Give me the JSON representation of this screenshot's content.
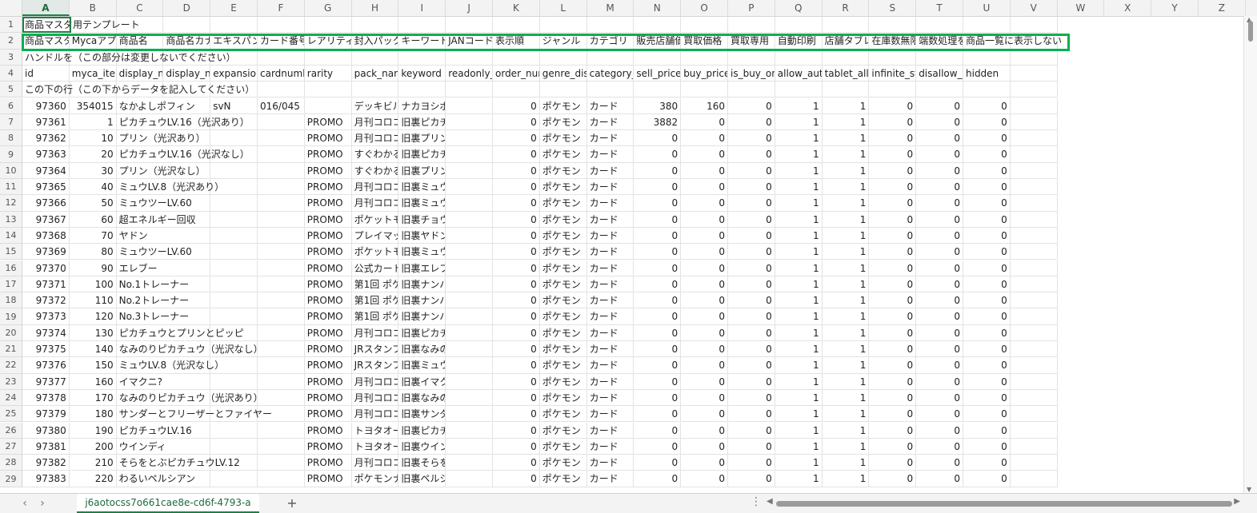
{
  "sheet_tab": "j6aotocss7o661cae8e-cd6f-4793-a",
  "columns": [
    "A",
    "B",
    "C",
    "D",
    "E",
    "F",
    "G",
    "H",
    "I",
    "J",
    "K",
    "L",
    "M",
    "N",
    "O",
    "P",
    "Q",
    "R",
    "S",
    "T",
    "U",
    "V",
    "W",
    "X",
    "Y",
    "Z"
  ],
  "active_column": "A",
  "rows": [
    {
      "n": "1",
      "cells": {
        "A": "商品マスタ用テンプレート"
      }
    },
    {
      "n": "2",
      "cells": {
        "A": "商品マスタ",
        "B": "Mycaアプ",
        "C": "商品名",
        "D": "商品名カナ",
        "E": "エキスパン",
        "F": "カード番号",
        "G": "レアリティ",
        "H": "封入パック",
        "I": "キーワード",
        "J": "JANコード",
        "K": "表示順",
        "L": "ジャンル",
        "M": "カテゴリ",
        "N": "販売店舗価",
        "O": "買取価格",
        "P": "買取専用",
        "Q": "自動印刷",
        "R": "店舗タブレ",
        "S": "在庫数無限",
        "T": "端数処理を",
        "U": "商品一覧に表示しない"
      }
    },
    {
      "n": "3",
      "cells": {
        "A": "ハンドルを（この部分は変更しないでください）"
      }
    },
    {
      "n": "4",
      "cells": {
        "A": "id",
        "B": "myca_item",
        "C": "display_na",
        "D": "display_na",
        "E": "expansion",
        "F": "cardnumb",
        "G": "rarity",
        "H": "pack_nam",
        "I": "keyword",
        "J": "readonly_j",
        "K": "order_num",
        "L": "genre_dis",
        "M": "category_d",
        "N": "sell_price",
        "O": "buy_price",
        "P": "is_buy_on",
        "Q": "allow_auto",
        "R": "tablet_allo",
        "S": "infinite_st",
        "T": "disallow_r",
        "U": "hidden"
      }
    },
    {
      "n": "5",
      "cells": {
        "A": "この下の行（この下からデータを記入してください）"
      }
    },
    {
      "n": "6",
      "cells": {
        "A": "97360",
        "B": "354015",
        "C": "なかよしポフィン",
        "E": "svN",
        "F": "016/045",
        "H": "デッキビル",
        "I": "ナカヨシポフィン な",
        "K": "0",
        "L": "ポケモン",
        "M": "カード",
        "N": "380",
        "O": "160",
        "P": "0",
        "Q": "1",
        "R": "1",
        "S": "0",
        "T": "0",
        "U": "0"
      }
    },
    {
      "n": "7",
      "cells": {
        "A": "97361",
        "B": "1",
        "C": "ピカチュウLV.16（光沢あり）",
        "G": "PROMO",
        "H": "月刊コロコ",
        "I": "旧裏ピカチュウ ピカ",
        "K": "0",
        "L": "ポケモン",
        "M": "カード",
        "N": "3882",
        "O": "0",
        "P": "0",
        "Q": "1",
        "R": "1",
        "S": "0",
        "T": "0",
        "U": "0"
      }
    },
    {
      "n": "8",
      "cells": {
        "A": "97362",
        "B": "10",
        "C": "プリン（光沢あり）",
        "G": "PROMO",
        "H": "月刊コロコ",
        "I": "旧裏プリン プリン ぷ",
        "K": "0",
        "L": "ポケモン",
        "M": "カード",
        "N": "0",
        "O": "0",
        "P": "0",
        "Q": "1",
        "R": "1",
        "S": "0",
        "T": "0",
        "U": "0"
      }
    },
    {
      "n": "9",
      "cells": {
        "A": "97363",
        "B": "20",
        "C": "ピカチュウLV.16（光沢なし）",
        "G": "PROMO",
        "H": "すぐわかる",
        "I": "旧裏ピカチュウ ピカ",
        "K": "0",
        "L": "ポケモン",
        "M": "カード",
        "N": "0",
        "O": "0",
        "P": "0",
        "Q": "1",
        "R": "1",
        "S": "0",
        "T": "0",
        "U": "0"
      }
    },
    {
      "n": "10",
      "cells": {
        "A": "97364",
        "B": "30",
        "C": "プリン（光沢なし）",
        "G": "PROMO",
        "H": "すぐわかる",
        "I": "旧裏プリン プリン ぷ",
        "K": "0",
        "L": "ポケモン",
        "M": "カード",
        "N": "0",
        "O": "0",
        "P": "0",
        "Q": "1",
        "R": "1",
        "S": "0",
        "T": "0",
        "U": "0"
      }
    },
    {
      "n": "11",
      "cells": {
        "A": "97365",
        "B": "40",
        "C": "ミュウLV.8（光沢あり）",
        "G": "PROMO",
        "H": "月刊コロコ",
        "I": "旧裏ミュウ ミュウ み",
        "K": "0",
        "L": "ポケモン",
        "M": "カード",
        "N": "0",
        "O": "0",
        "P": "0",
        "Q": "1",
        "R": "1",
        "S": "0",
        "T": "0",
        "U": "0"
      }
    },
    {
      "n": "12",
      "cells": {
        "A": "97366",
        "B": "50",
        "C": "ミュウツーLV.60",
        "G": "PROMO",
        "H": "月刊コロコ",
        "I": "旧裏ミュウツー ミュ",
        "K": "0",
        "L": "ポケモン",
        "M": "カード",
        "N": "0",
        "O": "0",
        "P": "0",
        "Q": "1",
        "R": "1",
        "S": "0",
        "T": "0",
        "U": "0"
      }
    },
    {
      "n": "13",
      "cells": {
        "A": "97367",
        "B": "60",
        "C": "超エネルギー回収",
        "G": "PROMO",
        "H": "ポケットモ",
        "I": "旧裏チョウエネルギー",
        "K": "0",
        "L": "ポケモン",
        "M": "カード",
        "N": "0",
        "O": "0",
        "P": "0",
        "Q": "1",
        "R": "1",
        "S": "0",
        "T": "0",
        "U": "0"
      }
    },
    {
      "n": "14",
      "cells": {
        "A": "97368",
        "B": "70",
        "C": "ヤドン",
        "G": "PROMO",
        "H": "プレイマッ",
        "I": "旧裏ヤドン やどん",
        "K": "0",
        "L": "ポケモン",
        "M": "カード",
        "N": "0",
        "O": "0",
        "P": "0",
        "Q": "1",
        "R": "1",
        "S": "0",
        "T": "0",
        "U": "0"
      }
    },
    {
      "n": "15",
      "cells": {
        "A": "97369",
        "B": "80",
        "C": "ミュウツーLV.60",
        "G": "PROMO",
        "H": "ポケットモ",
        "I": "旧裏ミュウツー ミュ",
        "K": "0",
        "L": "ポケモン",
        "M": "カード",
        "N": "0",
        "O": "0",
        "P": "0",
        "Q": "1",
        "R": "1",
        "S": "0",
        "T": "0",
        "U": "0"
      }
    },
    {
      "n": "16",
      "cells": {
        "A": "97370",
        "B": "90",
        "C": "エレブー",
        "G": "PROMO",
        "H": "公式カート",
        "I": "旧裏エレブー えれぶ",
        "K": "0",
        "L": "ポケモン",
        "M": "カード",
        "N": "0",
        "O": "0",
        "P": "0",
        "Q": "1",
        "R": "1",
        "S": "0",
        "T": "0",
        "U": "0"
      }
    },
    {
      "n": "17",
      "cells": {
        "A": "97371",
        "B": "100",
        "C": "No.1トレーナー",
        "G": "PROMO",
        "H": "第1回 ポケ",
        "I": "旧裏ナンバーワントL",
        "K": "0",
        "L": "ポケモン",
        "M": "カード",
        "N": "0",
        "O": "0",
        "P": "0",
        "Q": "1",
        "R": "1",
        "S": "0",
        "T": "0",
        "U": "0"
      }
    },
    {
      "n": "18",
      "cells": {
        "A": "97372",
        "B": "110",
        "C": "No.2トレーナー",
        "G": "PROMO",
        "H": "第1回 ポケ",
        "I": "旧裏ナンバーツートL",
        "K": "0",
        "L": "ポケモン",
        "M": "カード",
        "N": "0",
        "O": "0",
        "P": "0",
        "Q": "1",
        "R": "1",
        "S": "0",
        "T": "0",
        "U": "0"
      }
    },
    {
      "n": "19",
      "cells": {
        "A": "97373",
        "B": "120",
        "C": "No.3トレーナー",
        "G": "PROMO",
        "H": "第1回 ポケ",
        "I": "旧裏ナンバースリー",
        "K": "0",
        "L": "ポケモン",
        "M": "カード",
        "N": "0",
        "O": "0",
        "P": "0",
        "Q": "1",
        "R": "1",
        "S": "0",
        "T": "0",
        "U": "0"
      }
    },
    {
      "n": "20",
      "cells": {
        "A": "97374",
        "B": "130",
        "C": "ピカチュウとプリンとピッピ",
        "G": "PROMO",
        "H": "月刊コロコ",
        "I": "旧裏ピカチュウトプリ",
        "K": "0",
        "L": "ポケモン",
        "M": "カード",
        "N": "0",
        "O": "0",
        "P": "0",
        "Q": "1",
        "R": "1",
        "S": "0",
        "T": "0",
        "U": "0"
      }
    },
    {
      "n": "21",
      "cells": {
        "A": "97375",
        "B": "140",
        "C": "なみのりピカチュウ（光沢なし）",
        "G": "PROMO",
        "H": "JRスタンフ",
        "I": "旧裏なみのりピカチュ",
        "K": "0",
        "L": "ポケモン",
        "M": "カード",
        "N": "0",
        "O": "0",
        "P": "0",
        "Q": "1",
        "R": "1",
        "S": "0",
        "T": "0",
        "U": "0"
      }
    },
    {
      "n": "22",
      "cells": {
        "A": "97376",
        "B": "150",
        "C": "ミュウLV.8（光沢なし）",
        "G": "PROMO",
        "H": "JRスタンフ",
        "I": "旧裏ミュウ ミュウ み",
        "K": "0",
        "L": "ポケモン",
        "M": "カード",
        "N": "0",
        "O": "0",
        "P": "0",
        "Q": "1",
        "R": "1",
        "S": "0",
        "T": "0",
        "U": "0"
      }
    },
    {
      "n": "23",
      "cells": {
        "A": "97377",
        "B": "160",
        "C": "イマクニ?",
        "G": "PROMO",
        "H": "月刊コロコ",
        "I": "旧裏イマクニ いまく",
        "K": "0",
        "L": "ポケモン",
        "M": "カード",
        "N": "0",
        "O": "0",
        "P": "0",
        "Q": "1",
        "R": "1",
        "S": "0",
        "T": "0",
        "U": "0"
      }
    },
    {
      "n": "24",
      "cells": {
        "A": "97378",
        "B": "170",
        "C": "なみのりピカチュウ（光沢あり）",
        "G": "PROMO",
        "H": "月刊コロコ",
        "I": "旧裏なみのりピカチュ",
        "K": "0",
        "L": "ポケモン",
        "M": "カード",
        "N": "0",
        "O": "0",
        "P": "0",
        "Q": "1",
        "R": "1",
        "S": "0",
        "T": "0",
        "U": "0"
      }
    },
    {
      "n": "25",
      "cells": {
        "A": "97379",
        "B": "180",
        "C": "サンダーとフリーザーとファイヤー",
        "G": "PROMO",
        "H": "月刊コロコ",
        "I": "旧裏サンダートフリー",
        "K": "0",
        "L": "ポケモン",
        "M": "カード",
        "N": "0",
        "O": "0",
        "P": "0",
        "Q": "1",
        "R": "1",
        "S": "0",
        "T": "0",
        "U": "0"
      }
    },
    {
      "n": "26",
      "cells": {
        "A": "97380",
        "B": "190",
        "C": "ピカチュウLV.16",
        "G": "PROMO",
        "H": "トヨタオー",
        "I": "旧裏ピカチュウ ピカ",
        "K": "0",
        "L": "ポケモン",
        "M": "カード",
        "N": "0",
        "O": "0",
        "P": "0",
        "Q": "1",
        "R": "1",
        "S": "0",
        "T": "0",
        "U": "0"
      }
    },
    {
      "n": "27",
      "cells": {
        "A": "97381",
        "B": "200",
        "C": "ウインディ",
        "G": "PROMO",
        "H": "トヨタオー",
        "I": "旧裏ウインディ うい",
        "K": "0",
        "L": "ポケモン",
        "M": "カード",
        "N": "0",
        "O": "0",
        "P": "0",
        "Q": "1",
        "R": "1",
        "S": "0",
        "T": "0",
        "U": "0"
      }
    },
    {
      "n": "28",
      "cells": {
        "A": "97382",
        "B": "210",
        "C": "そらをとぶピカチュウLV.12",
        "G": "PROMO",
        "H": "月刊コロコ",
        "I": "旧裏そらをとぶピカチ",
        "K": "0",
        "L": "ポケモン",
        "M": "カード",
        "N": "0",
        "O": "0",
        "P": "0",
        "Q": "1",
        "R": "1",
        "S": "0",
        "T": "0",
        "U": "0"
      }
    },
    {
      "n": "29",
      "cells": {
        "A": "97383",
        "B": "220",
        "C": "わるいペルシアン",
        "G": "PROMO",
        "H": "ポケモンナ",
        "I": "旧裏ペルシアン ぺる",
        "K": "0",
        "L": "ポケモン",
        "M": "カード",
        "N": "0",
        "O": "0",
        "P": "0",
        "Q": "1",
        "R": "1",
        "S": "0",
        "T": "0",
        "U": "0"
      }
    }
  ]
}
